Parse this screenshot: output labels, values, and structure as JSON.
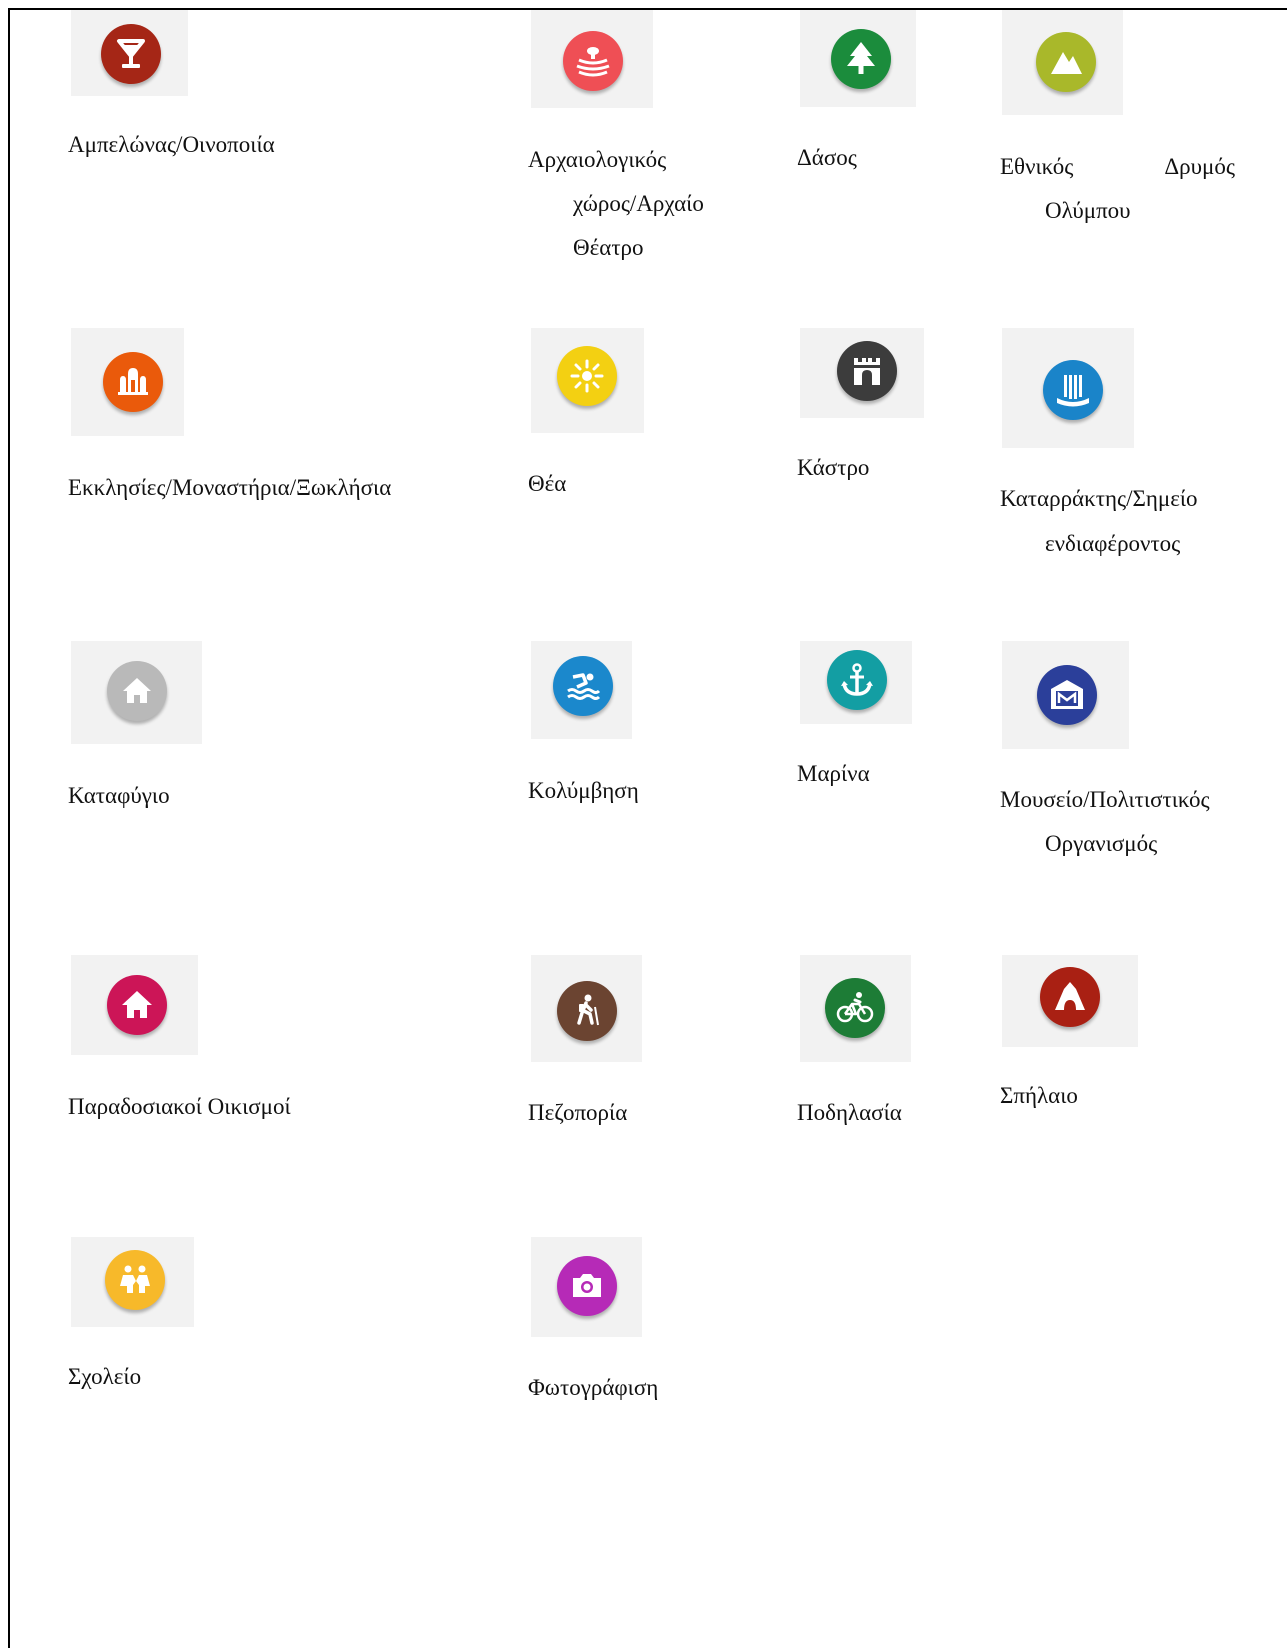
{
  "items": [
    {
      "label": "Αμπελώνας/Οινοποιία",
      "color": "#a52616",
      "icon": "wine-glass-icon"
    },
    {
      "label_lines": [
        "Αρχαιολογικός",
        "χώρος/Αρχαίο",
        "Θέατρο"
      ],
      "color": "#ef4f55",
      "icon": "archaeological-site-icon"
    },
    {
      "label": "Δάσος",
      "color": "#1b8c3c",
      "icon": "tree-icon"
    },
    {
      "label_words": [
        "Εθνικός",
        "Δρυμός"
      ],
      "label_line2": "Ολύμπου",
      "color": "#a9b82a",
      "icon": "mountain-icon"
    },
    {
      "label": "Εκκλησίες/Μοναστήρια/Ξωκλήσια",
      "color": "#ea5a0b",
      "icon": "church-icon"
    },
    {
      "label": "Θέα",
      "color": "#f3d012",
      "icon": "view-sun-icon"
    },
    {
      "label": "Κάστρο",
      "color": "#3c3c3c",
      "icon": "castle-icon"
    },
    {
      "label_lines": [
        "Καταρράκτης/Σημείο",
        "ενδιαφέροντος"
      ],
      "color": "#1a84c9",
      "icon": "waterfall-icon"
    },
    {
      "label": "Καταφύγιο",
      "color": "#b9b9b9",
      "icon": "shelter-house-icon"
    },
    {
      "label": "Κολύμβηση",
      "color": "#1b88cc",
      "icon": "swimming-icon"
    },
    {
      "label": "Μαρίνα",
      "color": "#139ea3",
      "icon": "anchor-icon"
    },
    {
      "label_lines": [
        "Μουσείο/Πολιτιστικός",
        "Οργανισμός"
      ],
      "color": "#2b3f9a",
      "icon": "museum-icon"
    },
    {
      "label": "Παραδοσιακοί Οικισμοί",
      "color": "#cc1557",
      "icon": "village-house-icon"
    },
    {
      "label": "Πεζοπορία",
      "color": "#6b4431",
      "icon": "hiking-icon"
    },
    {
      "label": "Ποδηλασία",
      "color": "#1d7c36",
      "icon": "cycling-icon"
    },
    {
      "label": "Σπήλαιο",
      "color": "#a92013",
      "icon": "cave-icon"
    },
    {
      "label": "Σχολείο",
      "color": "#f7b92a",
      "icon": "school-children-icon"
    },
    {
      "label": "Φωτογράφιση",
      "color": "#b62ab7",
      "icon": "camera-icon"
    }
  ]
}
